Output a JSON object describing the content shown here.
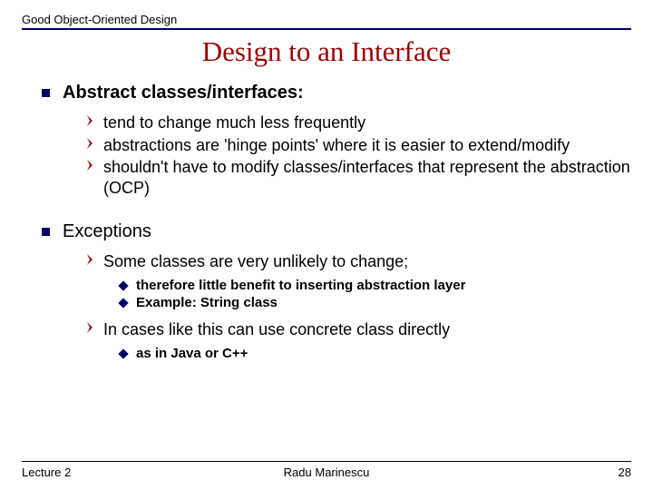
{
  "header": "Good Object-Oriented Design",
  "title": "Design to an Interface",
  "section1": {
    "heading": "Abstract classes/interfaces:",
    "items": [
      "tend to change much less frequently",
      " abstractions are 'hinge points' where it is easier to extend/modify",
      "shouldn't have to modify classes/interfaces that represent the abstraction (OCP)"
    ]
  },
  "section2": {
    "heading": "Exceptions",
    "item1": "Some classes are very unlikely to change;",
    "sub1": [
      "therefore little benefit to inserting abstraction layer",
      "Example: String class"
    ],
    "item2": "In cases like this can use concrete class directly",
    "sub2": [
      "as in Java or C++"
    ]
  },
  "footer": {
    "left": "Lecture 2",
    "center": "Radu Marinescu",
    "right": "28"
  }
}
